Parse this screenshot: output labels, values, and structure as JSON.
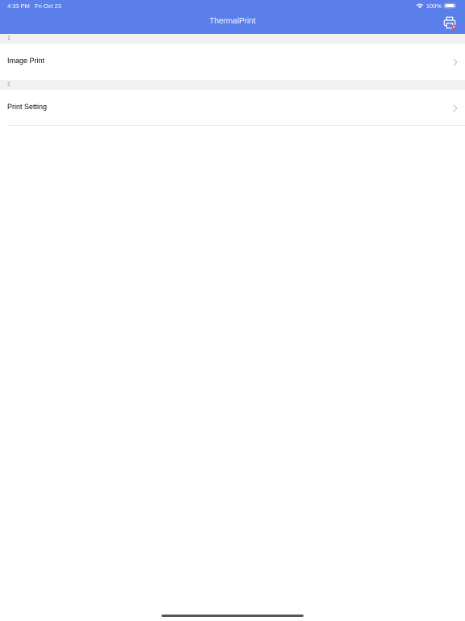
{
  "status_bar": {
    "time": "4:33 PM",
    "date": "Fri Oct 23",
    "battery_percent": "100%",
    "icons": [
      "wifi-icon",
      "battery-icon"
    ]
  },
  "nav_bar": {
    "title": "ThermalPrint",
    "right_icon": "printer-icon",
    "background_color": "#5a7fea"
  },
  "sections": [
    {
      "header": "1",
      "rows": [
        {
          "label": "Image Print",
          "accessory": "chevron-right-icon"
        }
      ]
    },
    {
      "header": "2",
      "rows": [
        {
          "label": "Print Setting",
          "accessory": "chevron-right-icon"
        }
      ]
    }
  ]
}
